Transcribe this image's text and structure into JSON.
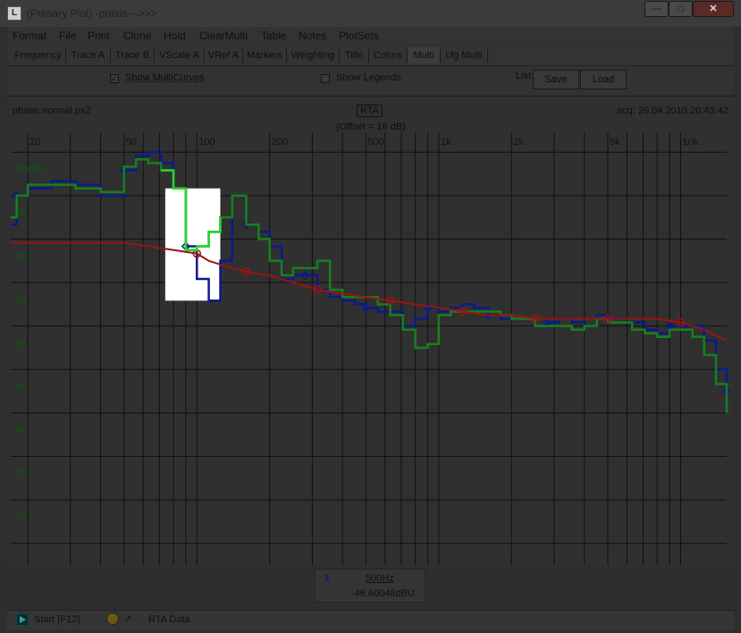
{
  "window": {
    "title": "(Primary Plot) -praxis--->>>",
    "app_icon_text": "L"
  },
  "menu": [
    "Format",
    "File",
    "Print",
    "Clone",
    "Hold",
    "ClearMulti",
    "Table",
    "Notes",
    "PlotSets"
  ],
  "tabs": [
    "Frequency",
    "Trace A",
    "Trace B",
    "VScale A",
    "VRef A",
    "Markers",
    "Weighting",
    "Title",
    "Colors",
    "Multi",
    "cfg Multi"
  ],
  "active_tab": "Multi",
  "controls": {
    "show_multicurves": {
      "label": "Show MultiCurves",
      "checked": true
    },
    "show_legends": {
      "label": "Show Legends",
      "checked": false
    },
    "list_label": "List:",
    "save_label": "Save",
    "load_label": "Load"
  },
  "plot_header": {
    "filename": "phase normal.px2",
    "mode": "RTA",
    "offset": "(Offset = 16 dB)",
    "acq": "acq: 26.04.2010 20:43:42"
  },
  "readout": {
    "channel": "1",
    "frequency": "500Hz",
    "value": "-46.60048dBU"
  },
  "status": {
    "start_label": "Start [F12]",
    "mode_label": "RTA Data"
  },
  "colors": {
    "blue": "#0b1a8c",
    "green": "#16801e",
    "bright_green": "#24d82c",
    "red": "#9a1414",
    "grid": "#111111",
    "plot_bg": "#303030",
    "highlight": "#ffffff"
  },
  "chart_data": {
    "type": "line",
    "title": "",
    "xlabel": "",
    "ylabel": "",
    "x_scale": "log",
    "xlim": [
      17,
      15500
    ],
    "ylim": [
      -84,
      -25
    ],
    "x_tick_labels": [
      "20",
      "50",
      "100",
      "200",
      "500",
      "1k",
      "2k",
      "5k",
      "10k"
    ],
    "x_tick_values": [
      20,
      50,
      100,
      200,
      500,
      1000,
      2000,
      5000,
      10000
    ],
    "y_tick_labels": [
      "-30dBU",
      "-36",
      "-42",
      "-48",
      "-54",
      "-60",
      "-66",
      "-72",
      "-78"
    ],
    "y_tick_values": [
      -30,
      -36,
      -42,
      -48,
      -54,
      -60,
      -66,
      -72,
      -78
    ],
    "grid": true,
    "series": [
      {
        "color": "blue",
        "x": [
          17,
          18,
          20,
          25,
          31.5,
          40,
          50,
          56,
          63,
          71,
          80,
          90,
          100,
          112,
          125,
          140,
          160,
          180,
          200,
          224,
          250,
          280,
          315,
          355,
          400,
          450,
          500,
          560,
          630,
          710,
          800,
          900,
          1000,
          1120,
          1250,
          1400,
          1600,
          1800,
          2000,
          2240,
          2500,
          2800,
          3150,
          3550,
          4000,
          4500,
          5000,
          5600,
          6300,
          7100,
          8000,
          9000,
          10000,
          11200,
          12500,
          14000,
          15500
        ],
        "y": [
          -37,
          -33,
          -32,
          -31,
          -31.5,
          -33,
          -29.5,
          -27.5,
          -27,
          -28.5,
          -32,
          -40,
          -44.5,
          -47.5,
          -42,
          -33,
          -37,
          -38,
          -40,
          -44.5,
          -44,
          -44,
          -46,
          -47,
          -47.5,
          -48,
          -48.5,
          -49,
          -49,
          -51,
          -50,
          -48.5,
          -49,
          -48.5,
          -48,
          -48.5,
          -49.5,
          -50,
          -50,
          -50,
          -51,
          -50.5,
          -50,
          -50.5,
          -51,
          -49.5,
          -50,
          -50,
          -50.5,
          -51.5,
          -52,
          -51,
          -51,
          -51,
          -53,
          -57,
          -60
        ]
      },
      {
        "color": "green",
        "x": [
          17,
          18,
          20,
          25,
          31.5,
          40,
          50,
          56,
          63,
          71,
          80,
          90,
          100,
          112,
          125,
          140,
          160,
          180,
          200,
          224,
          250,
          280,
          315,
          355,
          400,
          450,
          500,
          560,
          630,
          710,
          800,
          900,
          1000,
          1120,
          1250,
          1400,
          1600,
          1800,
          2000,
          2240,
          2500,
          2800,
          3150,
          3550,
          4000,
          4500,
          5000,
          5600,
          6300,
          7100,
          8000,
          9000,
          10000,
          11200,
          12500,
          14000,
          15500
        ],
        "y": [
          -36,
          -33,
          -31.5,
          -31.5,
          -32,
          -32.5,
          -29,
          -28,
          -28.5,
          -29.5,
          -32,
          -40.5,
          -40,
          -38,
          -36,
          -33,
          -37,
          -39,
          -42,
          -44,
          -43,
          -43,
          -42,
          -46,
          -47,
          -47,
          -47,
          -48,
          -49.5,
          -51.5,
          -54,
          -53.5,
          -49.5,
          -49,
          -49,
          -49,
          -49,
          -49.5,
          -50,
          -50,
          -51,
          -51,
          -51,
          -51.5,
          -51,
          -50,
          -50.5,
          -50.5,
          -51.5,
          -52,
          -52.5,
          -51.5,
          -51.5,
          -52.5,
          -55,
          -59,
          -63
        ]
      },
      {
        "color": "red",
        "x": [
          17,
          50,
          80,
          100,
          112,
          125,
          160,
          200,
          250,
          315,
          400,
          500,
          630,
          800,
          1000,
          1250,
          1600,
          2000,
          2500,
          3150,
          4000,
          5000,
          6300,
          8000,
          10000,
          12500,
          15500
        ],
        "y": [
          -39.5,
          -39.5,
          -40.5,
          -41,
          -42,
          -42.5,
          -43.5,
          -44,
          -45,
          -46,
          -46.5,
          -47,
          -47.5,
          -48,
          -48.5,
          -49,
          -49.5,
          -49.5,
          -50,
          -50,
          -50,
          -50,
          -50,
          -50,
          -50.5,
          -51.5,
          -53
        ]
      }
    ]
  }
}
